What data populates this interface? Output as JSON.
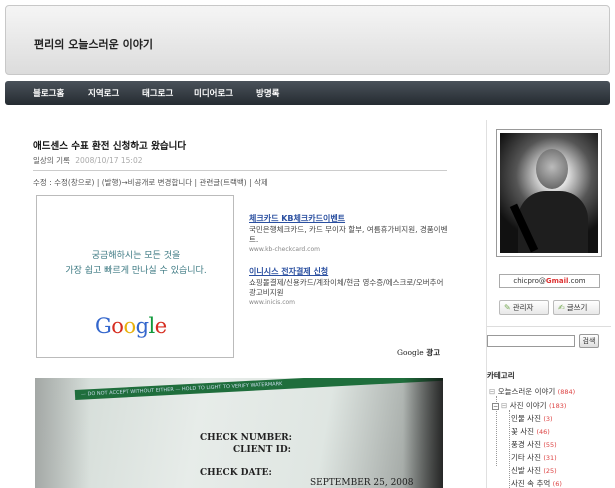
{
  "header": {
    "site_title": "편리의 오늘스러운 이야기"
  },
  "nav": [
    "블로그홈",
    "지역로그",
    "태그로그",
    "미디어로그",
    "방명록"
  ],
  "post": {
    "title": "애드센스 수표 환전 신청하고 왔습니다",
    "category": "일상의 기록",
    "date": "2008/10/17 15:02",
    "actions": "수정 : 수정(창으로) | (발행)→비공개로 변경합니다 | 관련글(트랙백) | 삭제"
  },
  "ad": {
    "image_text_line1": "궁금해하시는 모든 것을",
    "image_text_line2": "가장 쉽고 빠르게 만나실 수 있습니다.",
    "logo_text": "Google",
    "colors": {
      "g_blue": "#3366cc",
      "o_red": "#d62d20",
      "o_yellow": "#e8b10d",
      "l_green": "#119a3c"
    },
    "text_ads": [
      {
        "title": "체크카드 KB체크카드이벤트",
        "desc": "국민은행체크카드, 카드 무이자 할부, 여름휴가비지원, 경품이벤트.",
        "url": "www.kb-checkcard.com"
      },
      {
        "title": "이니시스 전자결제 신청",
        "desc": "쇼핑몰결제/신용카드/계좌이체/현금 영수증/에스크로/오버추어 광고비지원",
        "url": "www.inicis.com"
      }
    ],
    "label_google": "Google",
    "label_ad": "광고"
  },
  "check": {
    "banner": "— DO NOT ACCEPT WITHOUT EITHER — HOLD TO LIGHT TO VERIFY WATERMARK",
    "check_number_label": "CHECK NUMBER:",
    "client_id_label": "CLIENT ID:",
    "check_date_label": "CHECK DATE:",
    "check_date_value": "SEPTEMBER 25, 2008"
  },
  "sidebar": {
    "email_user": "chicpro@",
    "email_brand": "Gmail",
    "email_domain": ".com",
    "admin_button": "관리자",
    "write_button": "글쓰기",
    "search_placeholder": "",
    "search_button": "검색",
    "category_title": "카테고리",
    "categories": [
      {
        "label": "오늘스러운 이야기",
        "count": "(884)",
        "prefix": "",
        "box": ""
      },
      {
        "label": "사진 이야기",
        "count": "(183)",
        "prefix": "",
        "box": "−"
      },
      {
        "label": "인물 사진",
        "count": "(3)",
        "prefix": "",
        "box": ""
      },
      {
        "label": "꽃 사진",
        "count": "(46)",
        "prefix": "",
        "box": ""
      },
      {
        "label": "풍경 사진",
        "count": "(55)",
        "prefix": "",
        "box": ""
      },
      {
        "label": "기타 사진",
        "count": "(31)",
        "prefix": "",
        "box": ""
      },
      {
        "label": "신발 사진",
        "count": "(25)",
        "prefix": "",
        "box": ""
      },
      {
        "label": "사진 속 추억",
        "count": "(6)",
        "prefix": "",
        "box": ""
      }
    ]
  }
}
